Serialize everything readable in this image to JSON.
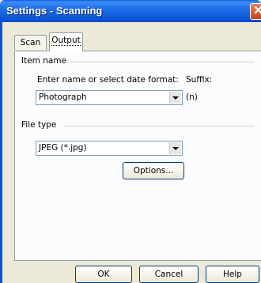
{
  "window": {
    "title": "Settings - Scanning",
    "close_glyph": "✕"
  },
  "tabs": [
    {
      "label": "Scan"
    },
    {
      "label": "Output",
      "selected": true
    }
  ],
  "item_name": {
    "group_label": "Item name",
    "prompt": "Enter name or select date format:",
    "suffix_label": "Suffix:",
    "value": "Photograph",
    "suffix_value": "(n)"
  },
  "file_type": {
    "group_label": "File type",
    "value": "JPEG (*.jpg)",
    "options_button": "Options..."
  },
  "footer": {
    "ok": "OK",
    "cancel": "Cancel",
    "help": "Help"
  }
}
